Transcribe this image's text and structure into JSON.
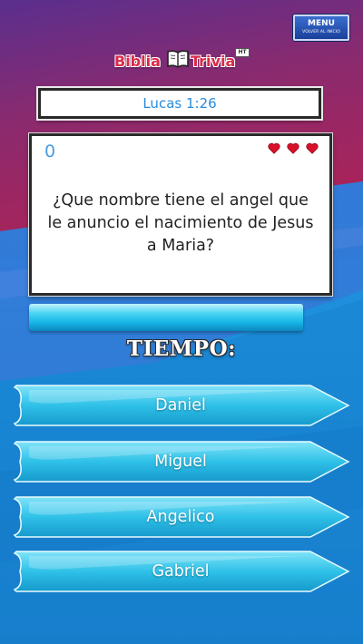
{
  "menu": {
    "title": "MENU",
    "subtitle": "VOLVER AL INICIO"
  },
  "logo": {
    "part1": "Biblia",
    "part2": "Trivia",
    "badge": "HT"
  },
  "verse": "Lucas 1:26",
  "score": "0",
  "lives": 3,
  "question": "¿Que nombre tiene el angel que le anuncio el nacimiento de Jesus a Maria?",
  "timer": {
    "label": "TIEMPO:",
    "remaining_fraction": 0.95
  },
  "answers": [
    {
      "label": "Daniel"
    },
    {
      "label": "Miguel"
    },
    {
      "label": "Angelico"
    },
    {
      "label": "Gabriel"
    }
  ],
  "colors": {
    "bg_top": "#7a2a78",
    "bg_bottom": "#1e8ad8",
    "heart": "#d8102a",
    "answer": "#2fc1e8",
    "verse_text": "#2a8bd8"
  }
}
